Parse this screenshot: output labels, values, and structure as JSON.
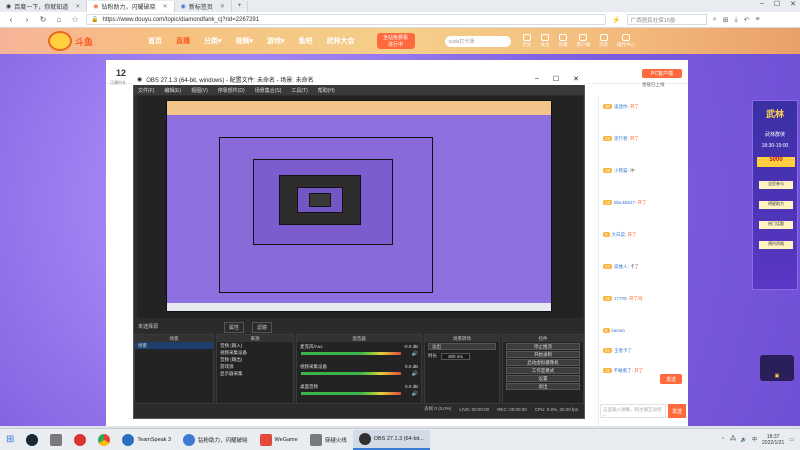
{
  "browser": {
    "tabs": [
      {
        "label": "百度一下，你就知道",
        "active": false
      },
      {
        "label": "钻粉助力，闪耀破晓",
        "active": true
      },
      {
        "label": "新标签页",
        "active": false
      }
    ],
    "url": "https://www.douyu.com/topic/diamondfank_cj?rid=2267291",
    "search_placeholder": "广西居民社保15投",
    "window_controls": [
      "–",
      "☐",
      "✕"
    ]
  },
  "douyu": {
    "nav": [
      "首页",
      "直播",
      "分类▾",
      "视频▾",
      "游戏▾",
      "鱼吧",
      "武林大会"
    ],
    "active_nav": "直播",
    "download": [
      "全站免费看",
      "进行中"
    ],
    "search_placeholder": "sudo打卡场",
    "header_icons": [
      "历史",
      "关注",
      "开播",
      "客户端",
      "消息",
      "操作中心"
    ],
    "room_number": "12",
    "room_sub": "正播时长",
    "pc_button": "PC客户端",
    "bubble": "星级已上线"
  },
  "side_ad": {
    "title": "武林",
    "subtitle": "武林群侠",
    "time": "18:30-19:00",
    "amount": "5000",
    "rows": [
      "全民参与",
      "明星助力",
      "热门话题",
      "预约资格"
    ]
  },
  "chat": {
    "rows": [
      {
        "lv": "30",
        "name": "凌迷你",
        "text": "开了"
      },
      {
        "lv": "22",
        "name": "逆行者",
        "text": "开了"
      },
      {
        "lv": "18",
        "name": "小熊猫",
        "text": "冲"
      },
      {
        "lv": "12",
        "name": "Black8647",
        "text": "开了"
      },
      {
        "lv": "9",
        "name": "大白菜",
        "text": "开了"
      },
      {
        "lv": "27",
        "name": "高维人",
        "text": "卡了"
      },
      {
        "lv": "15",
        "name": "177#9",
        "text": "开了吗"
      },
      {
        "lv": "8",
        "name": "kaman",
        "text": ""
      },
      {
        "lv": "21",
        "name": "王者卡了",
        "text": ""
      },
      {
        "lv": "11",
        "name": "不敢看了",
        "text": "开了"
      }
    ],
    "send_label": "发送",
    "input_placeholder": "这里输入弹幕，和主播互动吧~"
  },
  "obs": {
    "title": "OBS 27.1.3 (64-bit, windows) - 配置文件: 未命名 - 场景: 未命名",
    "menu": [
      "文件(F)",
      "编辑(E)",
      "视图(V)",
      "停靠部件(D)",
      "场景集合(S)",
      "工具(T)",
      "帮助(H)"
    ],
    "scene_label": "未选择源",
    "scene_tabs": [
      "属性",
      "滤镜"
    ],
    "panels": {
      "scenes": {
        "title": "场景",
        "items": [
          "场景"
        ]
      },
      "sources": {
        "title": "来源",
        "items": [
          "音频 (输入)",
          "视频采集设备",
          "音频 (输出)",
          "游戏源",
          "显示器采集"
        ]
      },
      "mixer": {
        "title": "混音器",
        "channels": [
          "麦克风/Aux",
          "视频采集设备",
          "桌面音频"
        ],
        "db": [
          "-0.0 dB",
          "0.0 dB",
          "0.0 dB"
        ]
      },
      "transitions": {
        "title": "场景转场",
        "type": "淡出",
        "duration_label": "时长",
        "duration": "300 ms"
      },
      "controls": {
        "title": "控件",
        "buttons": [
          "停止推流",
          "开始录制",
          "启动虚拟摄像机",
          "工作室模式",
          "设置",
          "退出"
        ]
      }
    },
    "status": [
      "丢帧 0 (0.0%)",
      "LIVE: 00:00:00",
      "REC: 00:00:00",
      "CPU: 0.8%, 30.00 fps"
    ]
  },
  "taskbar": {
    "apps": [
      {
        "label": "TeamSpeak 3",
        "color": "#2a6fbd",
        "active": false
      },
      {
        "label": "钻粉助力，闪耀破晓",
        "color": "#3a7bd5",
        "active": false
      },
      {
        "label": "WeGame",
        "color": "#e24a3b",
        "active": false
      },
      {
        "label": "穿越火线",
        "color": "#7a7a7a",
        "active": false
      },
      {
        "label": "OBS 27.1.3 (64-bit...",
        "color": "#303030",
        "active": true
      }
    ],
    "time": "18:37",
    "date": "2022/1/21"
  }
}
